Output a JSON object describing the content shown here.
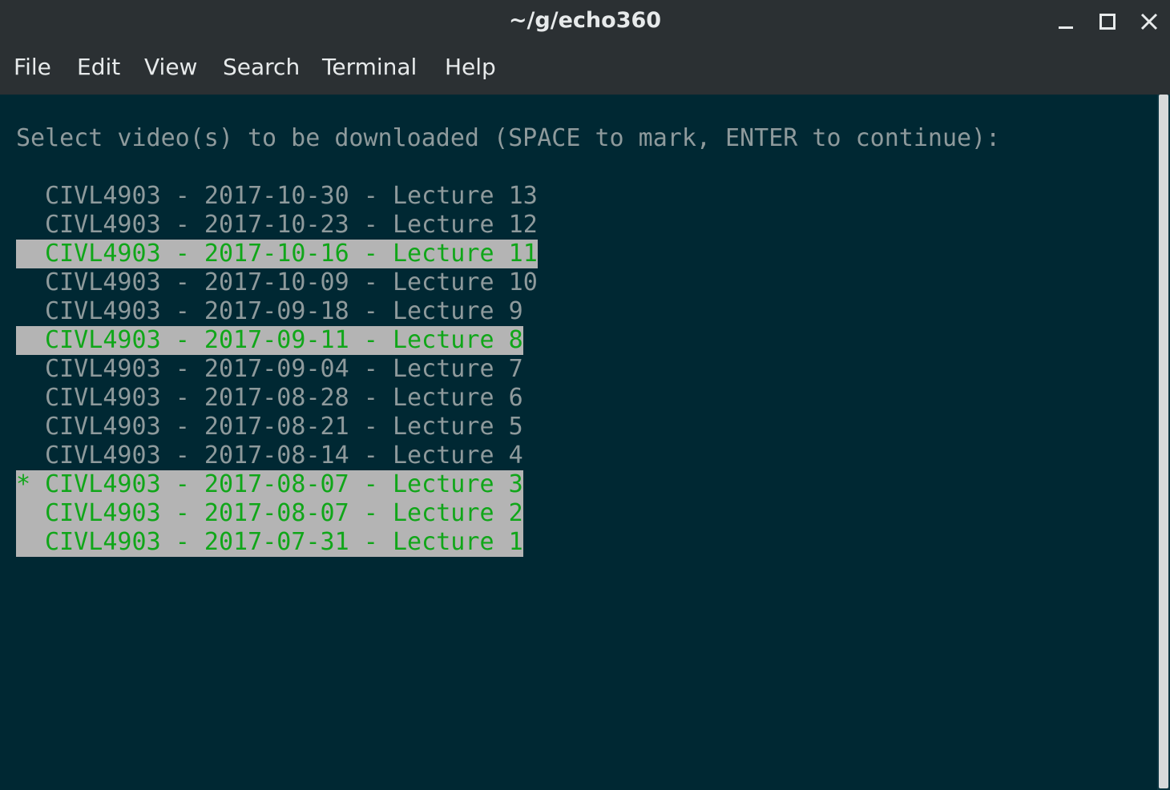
{
  "window": {
    "title": "~/g/echo360"
  },
  "menubar": {
    "items": [
      "File",
      "Edit",
      "View",
      "Search",
      "Terminal",
      "Help"
    ]
  },
  "terminal": {
    "prompt": "Select video(s) to be downloaded (SPACE to mark, ENTER to continue):",
    "cursor_marker": "*",
    "rows": [
      {
        "text": "CIVL4903 - 2017-10-30 - Lecture 13",
        "selected": false,
        "cursor": false
      },
      {
        "text": "CIVL4903 - 2017-10-23 - Lecture 12",
        "selected": false,
        "cursor": false
      },
      {
        "text": "CIVL4903 - 2017-10-16 - Lecture 11",
        "selected": true,
        "cursor": false
      },
      {
        "text": "CIVL4903 - 2017-10-09 - Lecture 10",
        "selected": false,
        "cursor": false
      },
      {
        "text": "CIVL4903 - 2017-09-18 - Lecture 9",
        "selected": false,
        "cursor": false
      },
      {
        "text": "CIVL4903 - 2017-09-11 - Lecture 8",
        "selected": true,
        "cursor": false
      },
      {
        "text": "CIVL4903 - 2017-09-04 - Lecture 7",
        "selected": false,
        "cursor": false
      },
      {
        "text": "CIVL4903 - 2017-08-28 - Lecture 6",
        "selected": false,
        "cursor": false
      },
      {
        "text": "CIVL4903 - 2017-08-21 - Lecture 5",
        "selected": false,
        "cursor": false
      },
      {
        "text": "CIVL4903 - 2017-08-14 - Lecture 4",
        "selected": false,
        "cursor": false
      },
      {
        "text": "CIVL4903 - 2017-08-07 - Lecture 3",
        "selected": true,
        "cursor": true
      },
      {
        "text": "CIVL4903 - 2017-08-07 - Lecture 2",
        "selected": true,
        "cursor": false
      },
      {
        "text": "CIVL4903 - 2017-07-31 - Lecture 1",
        "selected": true,
        "cursor": false
      }
    ]
  },
  "colors": {
    "terminal_bg": "#002833",
    "chrome_bg": "#2b3033",
    "text_default": "#8e9a9c",
    "text_selected": "#10a619",
    "selection_bg": "#b4b4b4"
  },
  "icons": {
    "minimize": "minimize-icon",
    "maximize": "maximize-icon",
    "close": "close-icon"
  }
}
